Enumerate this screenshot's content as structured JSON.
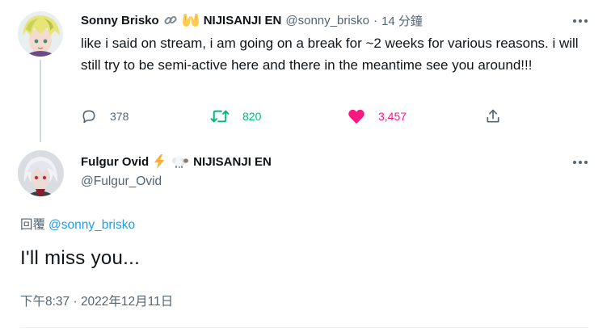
{
  "reply_parent": {
    "author": {
      "display_name": "Sonny Brisko",
      "emoji": [
        "link-emoji",
        "open-hands-emoji"
      ],
      "affiliation": "NIJISANJI EN",
      "handle": "@sonny_brisko"
    },
    "separator": "·",
    "time_ago": "14 分鐘",
    "text": "like i said on stream, i am going on a break for ~2 weeks for various reasons. i will still try to be semi-active here and there in the meantime see you around!!!",
    "actions": {
      "reply_count": "378",
      "retweet_count": "820",
      "like_count": "3,457"
    }
  },
  "tweet": {
    "author": {
      "display_name": "Fulgur Ovid",
      "emoji": [
        "lightning-emoji",
        "sheep-emoji"
      ],
      "affiliation": "NIJISANJI EN",
      "handle": "@Fulgur_Ovid"
    },
    "replying_to_label": "回覆",
    "replying_to_handle": "@sonny_brisko",
    "text": "I'll miss you...",
    "timestamp": "下午8:37 · 2022年12月11日"
  },
  "colors": {
    "text_primary": "#0f1419",
    "text_secondary": "#536471",
    "link": "#1d9bf0",
    "retweet": "#00ba7c",
    "like": "#f91880",
    "divider": "#cfd9de"
  }
}
